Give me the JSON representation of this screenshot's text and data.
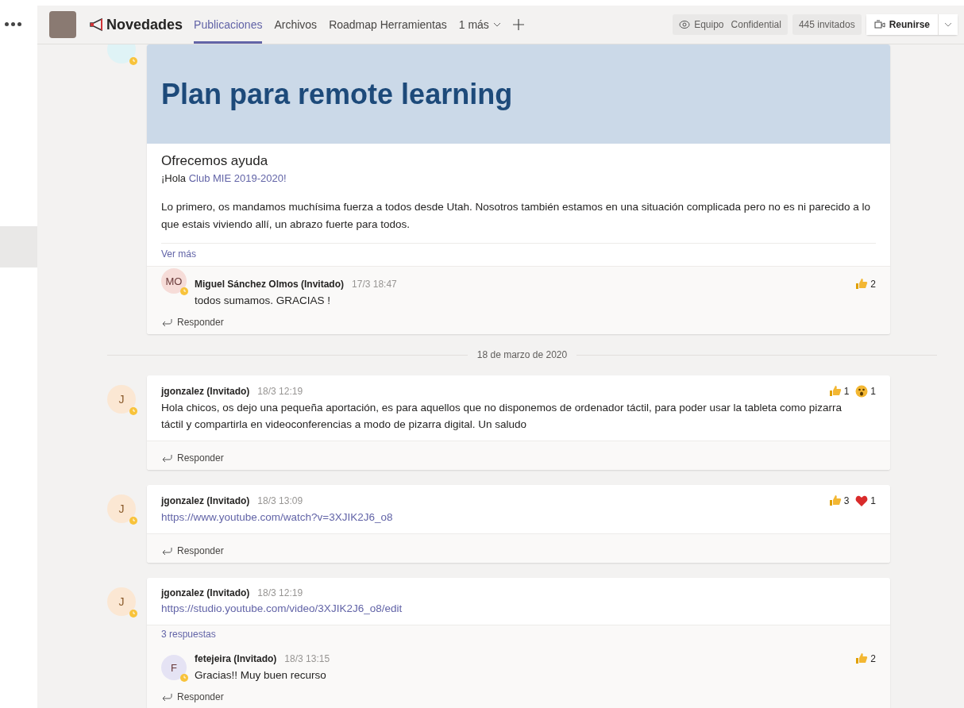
{
  "header": {
    "channel": "Novedades",
    "tabs": [
      {
        "label": "Publicaciones",
        "selected": true
      },
      {
        "label": "Archivos",
        "selected": false
      },
      {
        "label": "Roadmap Herramientas",
        "selected": false
      },
      {
        "label": "1 más",
        "selected": false,
        "kind": "more"
      }
    ],
    "team_type": "Equipo",
    "classification": "Confidential",
    "guests": "445 invitados",
    "meet": "Reunirse"
  },
  "threads": [
    {
      "kind": "announcement",
      "avatar": {
        "color": "#dff3f6"
      },
      "banner_title": "Plan para remote learning",
      "subject": "Ofrecemos ayuda",
      "greeting_prefix": "¡Hola ",
      "greeting_link": "Club MIE 2019-2020!",
      "body": "Lo primero, os mandamos muchísima fuerza a todos desde Utah. Nosotros también estamos en una situación complicada pero no es ni parecido a lo que estais viviendo allí, un abrazo fuerte para todos.",
      "see_more": "Ver más",
      "replies": [
        {
          "initials": "MO",
          "color": "#f6dcd8",
          "name": "Miguel Sánchez Olmos (Invitado)",
          "time": "17/3 18:47",
          "text": "todos sumamos. GRACIAS !",
          "reactions": [
            {
              "kind": "like",
              "count": "2"
            }
          ]
        }
      ],
      "reply_label": "Responder"
    },
    {
      "kind": "separator",
      "label": "18 de marzo de 2020"
    },
    {
      "kind": "message",
      "avatar": {
        "initials": "J",
        "color": "#fbe7d3"
      },
      "name": "jgonzalez (Invitado)",
      "time": "18/3 12:19",
      "text": "Hola chicos, os dejo una pequeña aportación, es para aquellos que no disponemos de ordenador táctil, para poder usar la tableta como pizarra táctil y compartirla en videoconferencias a modo de pizarra digital. Un saludo",
      "reactions": [
        {
          "kind": "like",
          "count": "1"
        },
        {
          "kind": "surprised",
          "count": "1"
        }
      ],
      "reply_label": "Responder"
    },
    {
      "kind": "message",
      "avatar": {
        "initials": "J",
        "color": "#fbe7d3"
      },
      "name": "jgonzalez (Invitado)",
      "time": "18/3 13:09",
      "link": "https://www.youtube.com/watch?v=3XJIK2J6_o8",
      "reactions": [
        {
          "kind": "like",
          "count": "3"
        },
        {
          "kind": "heart",
          "count": "1"
        }
      ],
      "reply_label": "Responder"
    },
    {
      "kind": "message",
      "avatar": {
        "initials": "J",
        "color": "#fbe7d3"
      },
      "name": "jgonzalez (Invitado)",
      "time": "18/3 12:19",
      "link": "https://studio.youtube.com/video/3XJIK2J6_o8/edit",
      "replies_count": "3 respuestas",
      "replies": [
        {
          "initials": "F",
          "color": "#e5e3f4",
          "name": "fetejeira (Invitado)",
          "time": "18/3 13:15",
          "text": "Gracias!! Muy buen recurso",
          "reactions": [
            {
              "kind": "like",
              "count": "2"
            }
          ]
        }
      ],
      "reply_label": "Responder"
    }
  ]
}
